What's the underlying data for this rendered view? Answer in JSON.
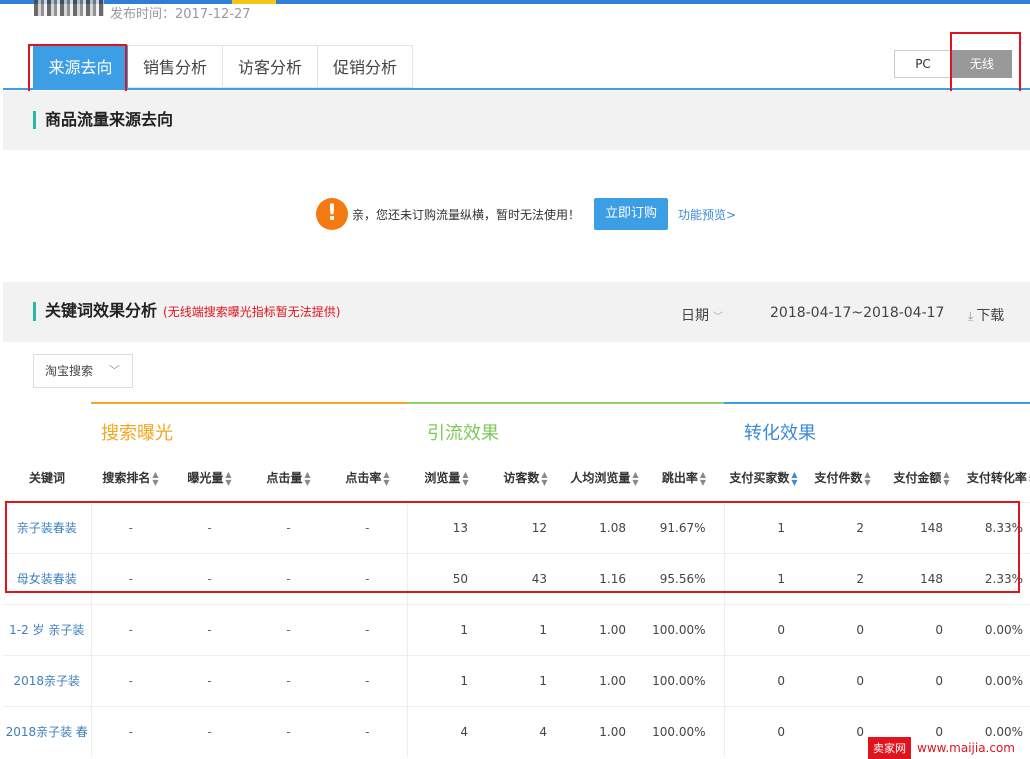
{
  "header": {
    "publish_date": "发布时间：2017-12-27"
  },
  "tabs": [
    "来源去向",
    "销售分析",
    "访客分析",
    "促销分析"
  ],
  "platform": {
    "pc": "PC",
    "wireless": "无线"
  },
  "traffic_section": {
    "title": "商品流量来源去向",
    "notice_icon": "!",
    "notice_text": "亲，您还未订购流量纵横，暂时无法使用！",
    "order_button": "立即订购",
    "preview_link": "功能预览>"
  },
  "keyword_section": {
    "title": "关键词效果分析",
    "note": "(无线端搜索曝光指标暂无法提供)",
    "date_label": "日期",
    "date_range": "2018-04-17~2018-04-17",
    "download": "下载",
    "source_select": "淘宝搜索"
  },
  "groups": {
    "search": "搜索曝光",
    "traffic": "引流效果",
    "conversion": "转化效果"
  },
  "columns": [
    "关键词",
    "搜索排名",
    "曝光量",
    "点击量",
    "点击率",
    "浏览量",
    "访客数",
    "人均浏览量",
    "跳出率",
    "支付买家数",
    "支付件数",
    "支付金额",
    "支付转化率"
  ],
  "rows": [
    [
      "亲子装春装",
      "-",
      "-",
      "-",
      "-",
      "13",
      "12",
      "1.08",
      "91.67%",
      "1",
      "2",
      "148",
      "8.33%"
    ],
    [
      "母女装春装",
      "-",
      "-",
      "-",
      "-",
      "50",
      "43",
      "1.16",
      "95.56%",
      "1",
      "2",
      "148",
      "2.33%"
    ],
    [
      "1-2 岁 亲子装",
      "-",
      "-",
      "-",
      "-",
      "1",
      "1",
      "1.00",
      "100.00%",
      "0",
      "0",
      "0",
      "0.00%"
    ],
    [
      "2018亲子装",
      "-",
      "-",
      "-",
      "-",
      "1",
      "1",
      "1.00",
      "100.00%",
      "0",
      "0",
      "0",
      "0.00%"
    ],
    [
      "2018亲子装 春",
      "-",
      "-",
      "-",
      "-",
      "4",
      "4",
      "1.00",
      "100.00%",
      "0",
      "0",
      "0",
      "0.00%"
    ]
  ],
  "watermark": {
    "logo": "卖家网",
    "url": "www.maijia.com"
  },
  "colors": {
    "accent": "#3c9ee5",
    "highlight": "#e0141e",
    "search": "#f5a623",
    "traffic": "#8fd36b"
  }
}
